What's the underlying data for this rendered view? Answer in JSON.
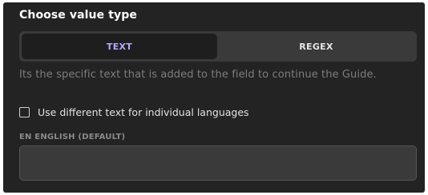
{
  "section": {
    "title": "Choose value type"
  },
  "value_type": {
    "options": [
      {
        "label": "TEXT",
        "selected": true
      },
      {
        "label": "REGEX",
        "selected": false
      }
    ]
  },
  "hint": "Its the specific text that is added to the field to continue the Guide.",
  "different_text": {
    "label": "Use different text for individual languages",
    "checked": false
  },
  "language": {
    "label": "EN ENGLISH (DEFAULT)",
    "value": "",
    "placeholder": ""
  },
  "colors": {
    "panel_bg": "#232323",
    "selected_option_text": "#b8a7ff",
    "hint_text": "#7d7d7d"
  }
}
